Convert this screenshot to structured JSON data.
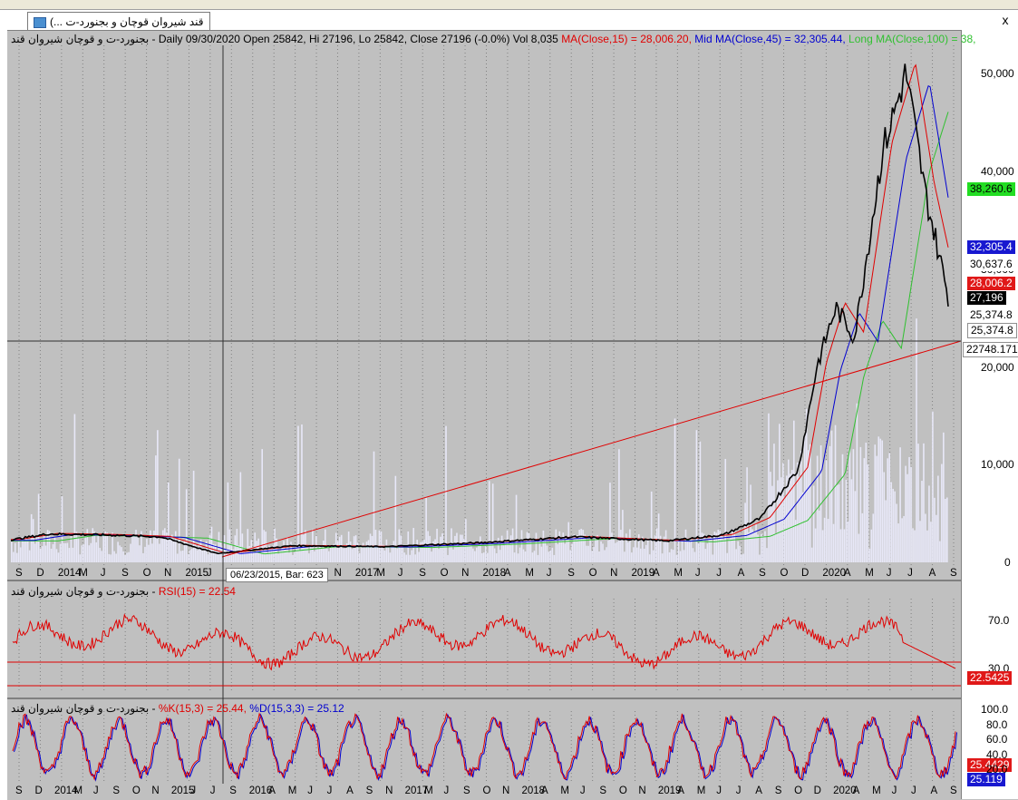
{
  "window": {
    "tab_title": "(... قند شیروان قوچان و بجنورد-ت",
    "close_label": "x"
  },
  "price_pane": {
    "header_prefix": "بجنورد-ت و قوچان شیروان قند - Daily 09/30/2020 Open 25842, Hi 27196, Lo 25842, Close 27196 (-0.0%) Vol 8,035",
    "ma_short": "MA(Close,15) = 28,006.20,",
    "ma_mid": "Mid MA(Close,45) = 32,305.44,",
    "ma_long": "Long MA(Close,100) = 38,",
    "y_ticks": [
      "50,000",
      "40,000",
      "30,000",
      "20,000",
      "10,000",
      "0"
    ],
    "value_boxes": {
      "long_ma": "38,260.6",
      "mid_ma": "32,305.4",
      "level_a": "30,637.6",
      "short_ma": "28,006.2",
      "close": "27,196",
      "level_b": "25,374.8",
      "level_c": "25,374.8",
      "trendline": "22748.171"
    },
    "x_ticks": [
      "S",
      "D",
      "2014",
      "M",
      "J",
      "S",
      "O",
      "N",
      "2015",
      "J",
      "M",
      "J",
      "J",
      "A",
      "S",
      "N",
      "2017",
      "M",
      "J",
      "S",
      "O",
      "N",
      "2018",
      "A",
      "M",
      "J",
      "S",
      "O",
      "N",
      "2019",
      "A",
      "M",
      "J",
      "J",
      "A",
      "S",
      "O",
      "D",
      "2020",
      "A",
      "M",
      "J",
      "J",
      "A",
      "S"
    ],
    "tooltip": "06/23/2015, Bar: 623"
  },
  "rsi_pane": {
    "header_prefix": "بجنورد-ت و قوچان شیروان قند -",
    "indicator": "RSI(15) = 22.54",
    "y_ticks": [
      "70.0",
      "30.0"
    ],
    "value_box": "22.5425"
  },
  "stoch_pane": {
    "header_prefix": "بجنورد-ت و قوچان شیروان قند -",
    "k_label": "%K(15,3) = 25.44,",
    "d_label": "%D(15,3,3) = 25.12",
    "y_ticks": [
      "100.0",
      "80.0",
      "60.0",
      "40.0",
      "20.0"
    ],
    "k_box": "25.4429",
    "d_box": "25.119",
    "x_ticks": [
      "S",
      "D",
      "2014",
      "M",
      "J",
      "S",
      "O",
      "N",
      "2015",
      "J",
      "J",
      "S",
      "2016",
      "A",
      "M",
      "J",
      "J",
      "A",
      "S",
      "N",
      "2017",
      "M",
      "J",
      "S",
      "O",
      "N",
      "2018",
      "A",
      "M",
      "J",
      "S",
      "O",
      "N",
      "2019",
      "A",
      "M",
      "J",
      "J",
      "A",
      "S",
      "O",
      "D",
      "2020",
      "A",
      "M",
      "J",
      "J",
      "A",
      "S"
    ]
  },
  "colors": {
    "pane_bg": "#c0c0c0",
    "volume": "#e8e8f8",
    "price": "#000000",
    "ma_short": "#e00000",
    "ma_mid": "#0000d0",
    "ma_long": "#30c030",
    "trendline": "#e00000",
    "rsi": "#e00000",
    "stoch_k": "#e00000",
    "stoch_d": "#0000d0"
  }
}
